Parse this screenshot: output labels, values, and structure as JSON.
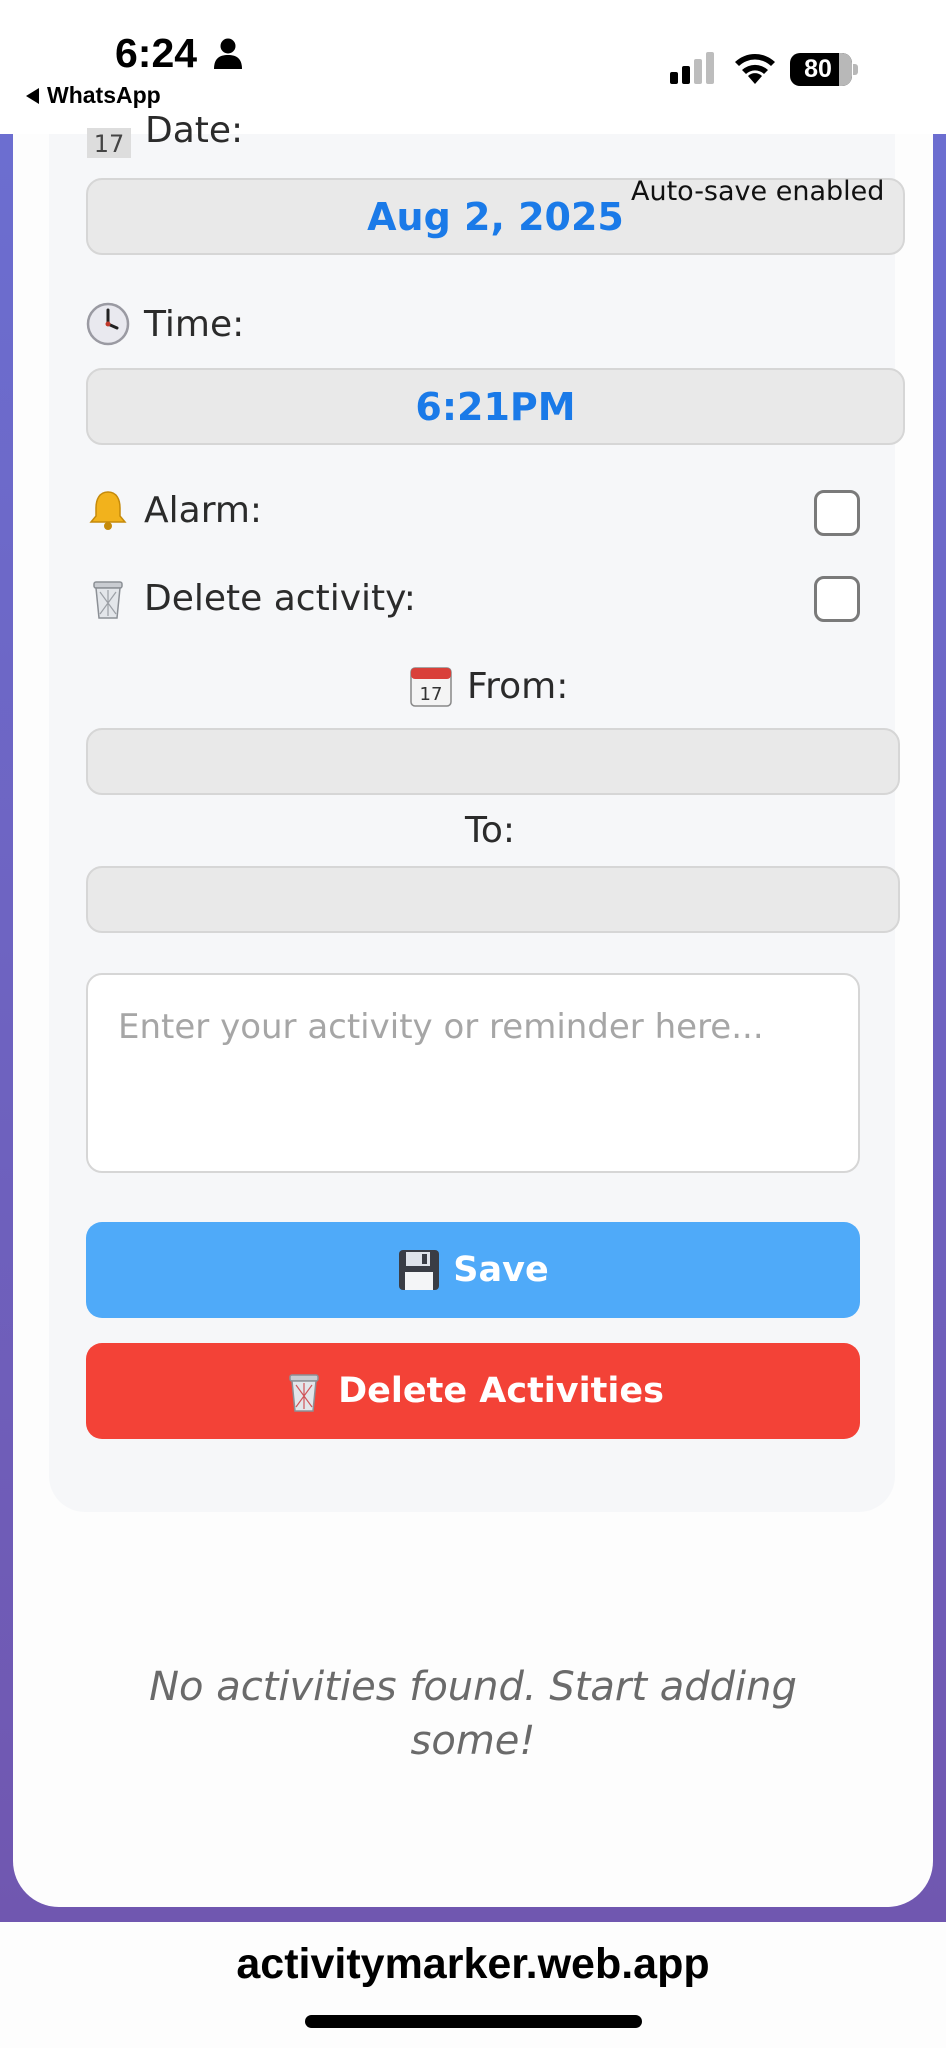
{
  "status_bar": {
    "time": "6:24",
    "back_app": "WhatsApp",
    "battery": "80",
    "battery_level_pct": 80
  },
  "form": {
    "date_label": "Date:",
    "date_icon_text": "17",
    "date_value": "Aug 2, 2025",
    "autosave": "Auto-save enabled",
    "time_label": "Time:",
    "time_value": "6:21PM",
    "alarm_label": "Alarm:",
    "alarm_checked": false,
    "delete_activity_label": "Delete activity:",
    "delete_activity_checked": false,
    "from_label": "From:",
    "from_value": "",
    "to_label": "To:",
    "to_value": "",
    "activity_placeholder": "Enter your activity or reminder here...",
    "save_label": "Save",
    "delete_activities_label": "Delete Activities"
  },
  "empty_state": "No activities found. Start adding some!",
  "url": "activitymarker.web.app",
  "icons": {
    "date": "calendar-icon",
    "time": "clock-icon",
    "alarm": "bell-icon",
    "delete": "wastebasket-icon",
    "from": "calendar-icon",
    "save": "floppy-disk-icon"
  },
  "colors": {
    "accent_blue": "#1a7ae8",
    "save_button": "#4faaf9",
    "delete_button": "#f34237",
    "background_gradient_top": "#6c6ed0",
    "background_gradient_bottom": "#7057b0"
  }
}
